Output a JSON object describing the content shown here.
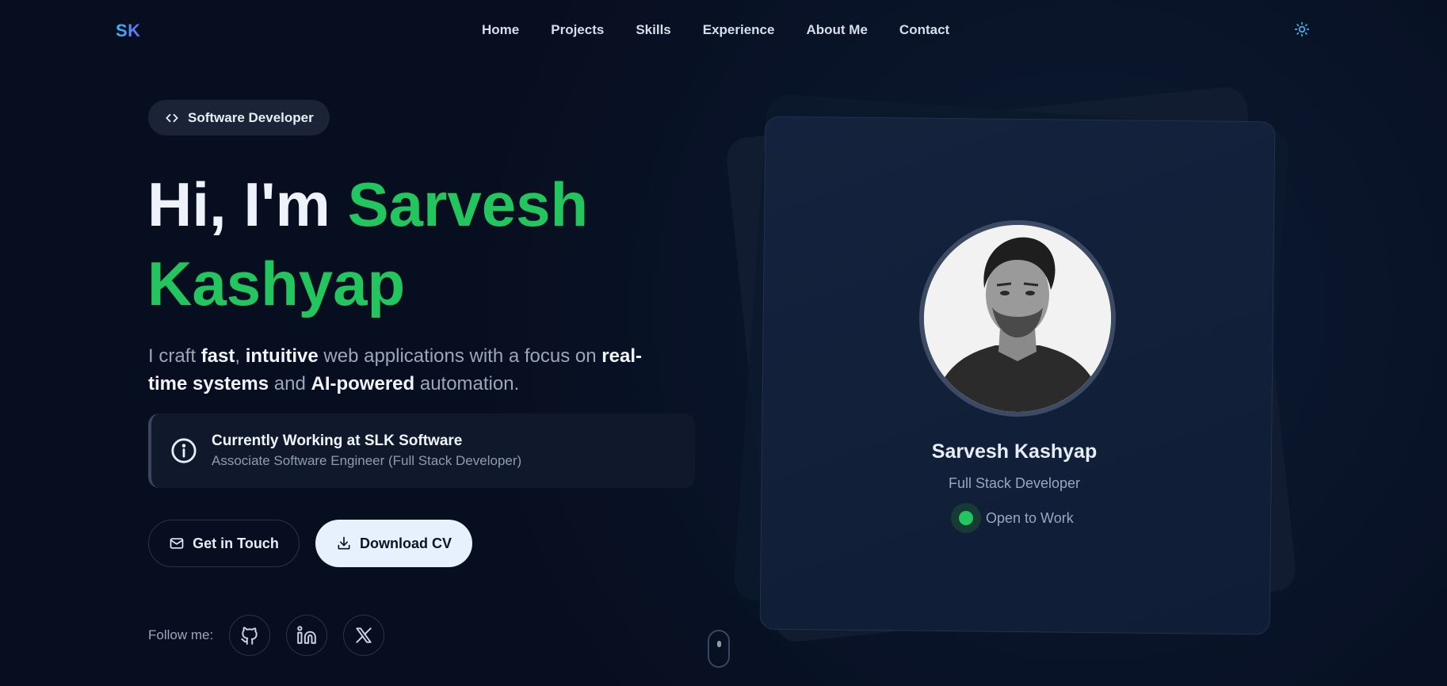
{
  "header": {
    "logo": "SK",
    "nav": [
      "Home",
      "Projects",
      "Skills",
      "Experience",
      "About Me",
      "Contact"
    ],
    "theme_icon": "sun-icon"
  },
  "hero": {
    "role_pill": "Software Developer",
    "title_prefix": "Hi, I'm ",
    "title_name_1": "Sarvesh",
    "title_name_2": "Kashyap",
    "desc": {
      "p1": "I craft ",
      "b1": "fast",
      "p2": ", ",
      "b2": "intuitive",
      "p3": " web applications with a focus on ",
      "b3": "real-time systems",
      "p4": " and ",
      "b4": "AI-powered",
      "p5": " automation."
    },
    "work": {
      "title": "Currently Working at SLK Software",
      "subtitle": "Associate Software Engineer (Full Stack Developer)"
    },
    "buttons": {
      "contact": "Get in Touch",
      "cv": "Download CV"
    },
    "follow_label": "Follow me:",
    "socials": [
      "github-icon",
      "linkedin-icon",
      "x-icon"
    ]
  },
  "profile": {
    "name": "Sarvesh Kashyap",
    "role": "Full Stack Developer",
    "status": "Open to Work",
    "status_color": "#22c55e"
  },
  "colors": {
    "background": "#070e1f",
    "accent": "#22c55e",
    "button_solid": "#e6f1fd"
  }
}
